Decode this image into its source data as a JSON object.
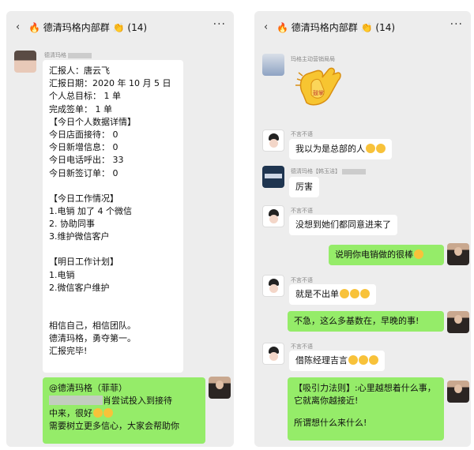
{
  "left": {
    "header": {
      "back_icon": "‹",
      "title": "德清玛格内部群",
      "count": "(14)",
      "more_icon": "···"
    },
    "msg1": {
      "sender": "德清玛格",
      "lines": [
        "汇报人：唐云飞",
        "汇报日期：2020 年 10 月 5 日",
        "个人总目标：   1 单",
        "完成签单：    1 单",
        "【今日个人数据详情】",
        "今日店面接待：  0",
        "今日新增信息：  0",
        "今日电话呼出：  33",
        "今日新签订单：  0",
        "",
        "【今日工作情况】",
        "1.电销   加了 4 个微信",
        "2. 协助同事",
        "3.维护微信客户",
        "",
        "【明日工作计划】",
        "1.电销",
        "2.微信客户维护",
        "",
        "",
        "相信自己，相信团队。",
        "德清玛格，勇夺第一。",
        "汇报完毕!"
      ]
    },
    "reply": {
      "mention": "@德清玛格（菲菲）",
      "line2": "肖尝试投入到接待",
      "line3": "中来，很好",
      "line4": "需要树立更多信心，大家会帮助你"
    }
  },
  "right": {
    "header": {
      "back_icon": "‹",
      "title": "德清玛格内部群",
      "count": "(14)",
      "more_icon": "···"
    },
    "sticker": {
      "sender": "玛格主动营销局局",
      "caption": "鼓掌"
    },
    "m1": {
      "sender": "不言不语",
      "text": "我以为是总部的人"
    },
    "m2": {
      "sender": "德清玛格【韩玉洁】",
      "text": "厉害"
    },
    "m3": {
      "sender": "不言不语",
      "text": "没想到她们都同意进来了"
    },
    "m4": {
      "text": "说明你电销做的很棒"
    },
    "m5": {
      "sender": "不言不语",
      "text": "就是不出单"
    },
    "m6": {
      "text": "不急，这么多基数在，早晚的事!"
    },
    "m7": {
      "sender": "不言不语",
      "text": "借陈经理吉言"
    },
    "m8": {
      "line1": "【吸引力法则】:心里越想着什么事，",
      "line2": "它就离你越接近!",
      "line3": "所谓想什么来什么!"
    }
  }
}
